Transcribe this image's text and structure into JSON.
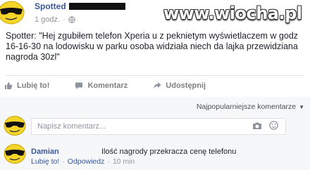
{
  "post": {
    "author": "Spotted",
    "time": "1 godz.",
    "separator": "·",
    "text": "Spotter: \"Hej zgubiłem telefon Xperia u z peknietym wyświetlaczem w godz 16-16-30 na lodowisku w parku osoba widziała niech da lajka przewidziana nagroda 30zl\""
  },
  "watermark": "www.wiocha.pl",
  "actions": {
    "like": "Lubię to!",
    "comment": "Komentarz",
    "share": "Udostępnij"
  },
  "comments": {
    "sort_label": "Najpopularniejsze komentarze",
    "input_placeholder": "Napisz komentarz...",
    "items": [
      {
        "author": "Damian",
        "text": "Ilość nagrody przekracza cenę telefonu",
        "like": "Lubię to!",
        "reply": "Odpowiedz",
        "separator": "·",
        "time": "10 min"
      }
    ]
  },
  "colors": {
    "link": "#3b5998",
    "muted": "#90949c",
    "comments_bg": "#f6f7f9"
  },
  "icons": {
    "avatar": "sunglasses-smiley-icon",
    "globe": "globe-icon",
    "like": "thumbs-up-icon",
    "comment": "speech-bubble-icon",
    "share": "share-arrow-icon",
    "camera": "camera-icon",
    "emoji": "smiley-icon"
  }
}
